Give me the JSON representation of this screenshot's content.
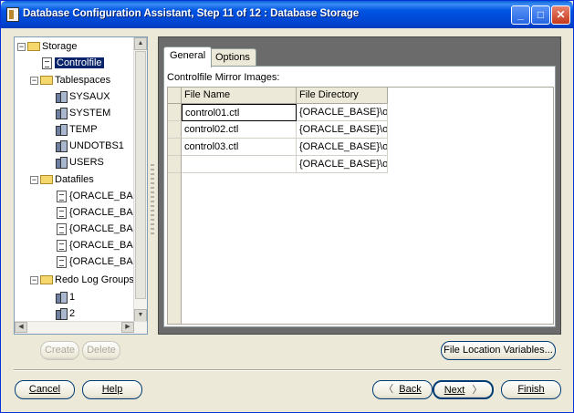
{
  "window": {
    "title": "Database Configuration Assistant, Step 11 of 12 : Database Storage",
    "min_label": "_",
    "max_label": "□",
    "close_label": "✕"
  },
  "tree": {
    "root": "Storage",
    "controlfile": "Controlfile",
    "tablespaces_label": "Tablespaces",
    "tablespaces": [
      "SYSAUX",
      "SYSTEM",
      "TEMP",
      "UNDOTBS1",
      "USERS"
    ],
    "datafiles_label": "Datafiles",
    "datafiles": [
      "{ORACLE_BASE",
      "{ORACLE_BASE",
      "{ORACLE_BASE",
      "{ORACLE_BASE",
      "{ORACLE_BASE"
    ],
    "redo_label": "Redo Log Groups",
    "redo_groups": [
      "1",
      "2"
    ]
  },
  "tabs": {
    "general": "General",
    "options": "Options"
  },
  "controlfile_panel": {
    "label": "Controlfile Mirror Images:",
    "columns": [
      "File Name",
      "File Directory"
    ],
    "rows": [
      [
        "control01.ctl",
        "{ORACLE_BASE}\\o..."
      ],
      [
        "control02.ctl",
        "{ORACLE_BASE}\\o..."
      ],
      [
        "control03.ctl",
        "{ORACLE_BASE}\\o..."
      ],
      [
        "",
        "{ORACLE_BASE}\\o..."
      ]
    ]
  },
  "buttons": {
    "create": "Create",
    "delete": "Delete",
    "file_location_variables": "File Location Variables...",
    "cancel": "Cancel",
    "help": "Help",
    "back": "Back",
    "next": "Next",
    "finish": "Finish",
    "back_arrow": "〈",
    "next_arrow": "〉"
  },
  "colors": {
    "titlebar": "#0054e3",
    "selection": "#0a246a",
    "window_bg": "#ece9d8",
    "panel_bg": "#6b6b6b"
  }
}
